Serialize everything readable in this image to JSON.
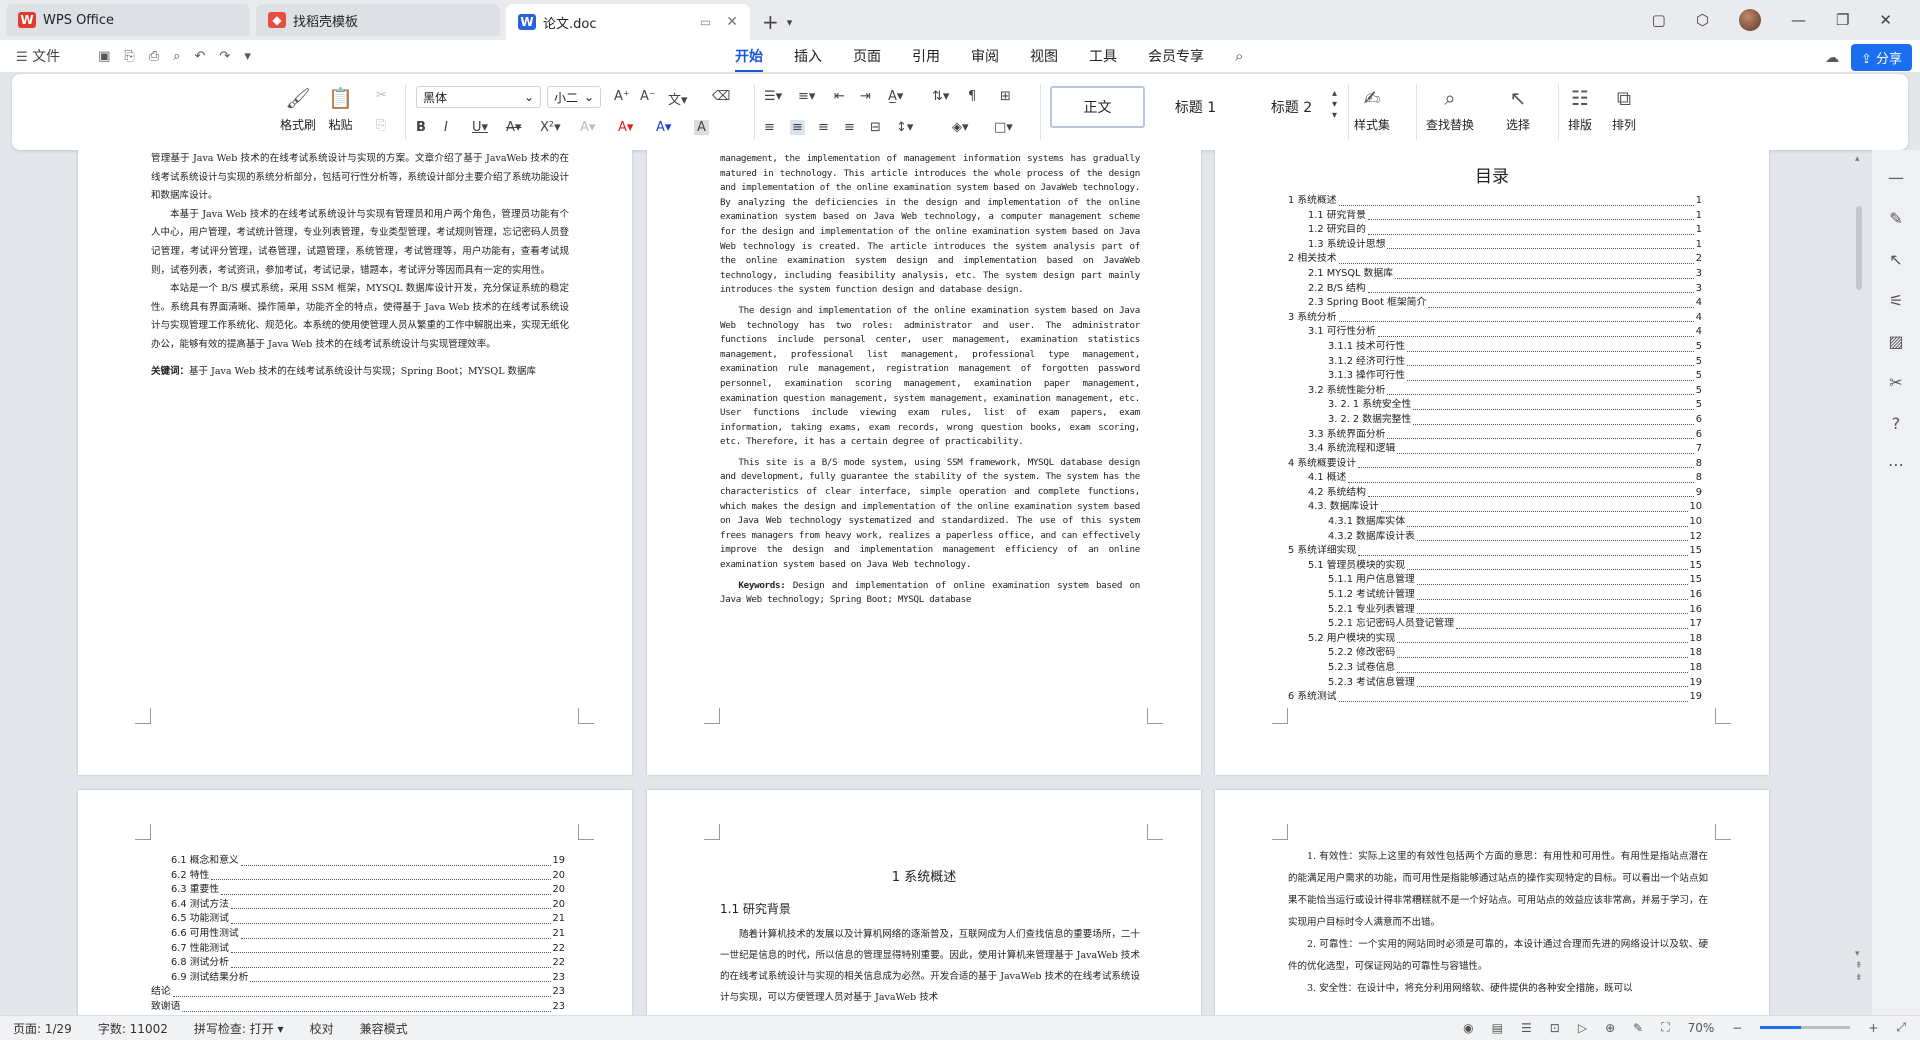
{
  "tabs": [
    {
      "label": "WPS Office",
      "icon": "wps-logo"
    },
    {
      "label": "找稻壳模板",
      "icon": "docer-logo"
    },
    {
      "label": "论文.doc",
      "icon": "word-doc-icon"
    }
  ],
  "menu": {
    "file": "文件",
    "tabs": [
      "开始",
      "插入",
      "页面",
      "引用",
      "审阅",
      "视图",
      "工具",
      "会员专享"
    ],
    "share": "分享"
  },
  "ribbon": {
    "format_painter": "格式刷",
    "paste": "粘贴",
    "font_name": "黑体",
    "font_size": "小二",
    "styles": [
      "正文",
      "标题 1",
      "标题 2"
    ],
    "style_set": "样式集",
    "find_replace": "查找替换",
    "select": "选择",
    "layout": "排版",
    "arrange": "排列"
  },
  "page1": {
    "paras": [
      "管理基于 Java Web 技术的在线考试系统设计与实现的方案。文章介绍了基于 JavaWeb 技术的在线考试系统设计与实现的系统分析部分，包括可行性分析等，系统设计部分主要介绍了系统功能设计和数据库设计。",
      "本基于 Java Web 技术的在线考试系统设计与实现有管理员和用户两个角色，管理员功能有个人中心，用户管理，考试统计管理，专业列表管理，专业类型管理，考试规则管理，忘记密码人员登记管理，考试评分管理，试卷管理，试题管理，系统管理，考试管理等，用户功能有，查看考试规则，试卷列表，考试资讯，参加考试，考试记录，错题本，考试评分等因而具有一定的实用性。",
      "本站是一个 B/S 模式系统，采用 SSM 框架，MYSQL 数据库设计开发，充分保证系统的稳定性。系统具有界面清晰、操作简单，功能齐全的特点，使得基于 Java Web 技术的在线考试系统设计与实现管理工作系统化、规范化。本系统的使用使管理人员从繁重的工作中解脱出来，实现无纸化办公，能够有效的提高基于 Java Web 技术的在线考试系统设计与实现管理效率。"
    ],
    "keywords_label": "关键词：",
    "keywords": "基于 Java Web 技术的在线考试系统设计与实现；Spring Boot；MYSQL 数据库"
  },
  "page2": {
    "paras": [
      "management, the implementation of management information systems has gradually matured in technology. This article introduces the whole process of the design and implementation of the online examination system based on JavaWeb technology. By analyzing the deficiencies in the design and implementation of the online examination system based on Java Web technology, a computer management scheme for the design and implementation of the online examination system based on Java Web technology is created. The article introduces the system analysis part of the online examination system design and implementation based on JavaWeb technology, including feasibility analysis, etc. The system design part mainly introduces the system function design and database design.",
      "The design and implementation of the online examination system based on Java Web technology has two roles: administrator and user. The administrator functions include personal center, user management, examination statistics management, professional list management, professional type management, examination rule management, registration management of forgotten password personnel, examination scoring management, examination paper management, examination question management, system management, examination management, etc. User functions include viewing exam rules, list of exam papers, exam information, taking exams, exam records, wrong question books, exam scoring, etc. Therefore, it has a certain degree of practicability.",
      "This site is a B/S mode system, using SSM framework, MYSQL database design and development, fully guarantee the stability of the system. The system has the characteristics of clear interface, simple operation and complete functions, which makes the design and implementation of the online examination system based on Java Web technology systematized and standardized. The use of this system frees managers from heavy work, realizes a paperless office, and can effectively improve the design and implementation management efficiency of an online examination system based on Java Web technology."
    ],
    "keywords_label": "Keywords:",
    "keywords": "Design and implementation of online examination system based on Java Web technology; Spring Boot; MYSQL database"
  },
  "page3": {
    "title": "目录",
    "toc": [
      {
        "t": "1 系统概述",
        "p": "1",
        "l": 0
      },
      {
        "t": "1.1 研究背景",
        "p": "1",
        "l": 1
      },
      {
        "t": "1.2 研究目的",
        "p": "1",
        "l": 1
      },
      {
        "t": "1.3 系统设计思想",
        "p": "1",
        "l": 1
      },
      {
        "t": "2 相关技术",
        "p": "2",
        "l": 0
      },
      {
        "t": "2.1 MYSQL 数据库",
        "p": "3",
        "l": 1
      },
      {
        "t": "2.2 B/S 结构",
        "p": "3",
        "l": 1
      },
      {
        "t": "2.3 Spring Boot 框架简介",
        "p": "4",
        "l": 1
      },
      {
        "t": "3 系统分析",
        "p": "4",
        "l": 0
      },
      {
        "t": "3.1 可行性分析",
        "p": "4",
        "l": 1
      },
      {
        "t": "3.1.1 技术可行性",
        "p": "5",
        "l": 2
      },
      {
        "t": "3.1.2 经济可行性",
        "p": "5",
        "l": 2
      },
      {
        "t": "3.1.3 操作可行性",
        "p": "5",
        "l": 2
      },
      {
        "t": "3.2 系统性能分析",
        "p": "5",
        "l": 1
      },
      {
        "t": "3. 2. 1  系统安全性",
        "p": "5",
        "l": 2
      },
      {
        "t": "3. 2. 2  数据完整性",
        "p": "6",
        "l": 2
      },
      {
        "t": "3.3 系统界面分析",
        "p": "6",
        "l": 1
      },
      {
        "t": "3.4 系统流程和逻辑",
        "p": "7",
        "l": 1
      },
      {
        "t": "4 系统概要设计",
        "p": "8",
        "l": 0
      },
      {
        "t": "4.1 概述",
        "p": "8",
        "l": 1
      },
      {
        "t": "4.2 系统结构",
        "p": "9",
        "l": 1
      },
      {
        "t": "4.3. 数据库设计",
        "p": "10",
        "l": 1
      },
      {
        "t": "4.3.1 数据库实体",
        "p": "10",
        "l": 2
      },
      {
        "t": "4.3.2 数据库设计表",
        "p": "12",
        "l": 2
      },
      {
        "t": "5 系统详细实现",
        "p": "15",
        "l": 0
      },
      {
        "t": "5.1  管理员模块的实现",
        "p": "15",
        "l": 1
      },
      {
        "t": "5.1.1  用户信息管理",
        "p": "15",
        "l": 2
      },
      {
        "t": "5.1.2  考试统计管理",
        "p": "16",
        "l": 2
      },
      {
        "t": "5.2.1  专业列表管理",
        "p": "16",
        "l": 2
      },
      {
        "t": "5.2.1  忘记密码人员登记管理",
        "p": "17",
        "l": 2
      },
      {
        "t": "5.2  用户模块的实现",
        "p": "18",
        "l": 1
      },
      {
        "t": "5.2.2  修改密码",
        "p": "18",
        "l": 2
      },
      {
        "t": "5.2.3  试卷信息",
        "p": "18",
        "l": 2
      },
      {
        "t": "5.2.3  考试信息管理",
        "p": "19",
        "l": 2
      },
      {
        "t": "6 系统测试",
        "p": "19",
        "l": 0
      }
    ]
  },
  "page4": {
    "toc": [
      {
        "t": "6.1 概念和意义",
        "p": "19"
      },
      {
        "t": "6.2 特性",
        "p": "20"
      },
      {
        "t": "6.3 重要性",
        "p": "20"
      },
      {
        "t": "6.4 测试方法",
        "p": "20"
      },
      {
        "t": "6.5  功能测试",
        "p": "21"
      },
      {
        "t": "6.6 可用性测试",
        "p": "21"
      },
      {
        "t": "6.7 性能测试",
        "p": "22"
      },
      {
        "t": "6.8 测试分析",
        "p": "22"
      },
      {
        "t": "6.9 测试结果分析",
        "p": "23"
      },
      {
        "t": "结论",
        "p": "23",
        "l": 0
      },
      {
        "t": "致谢语",
        "p": "23",
        "l": 0
      }
    ]
  },
  "page5": {
    "h1": "1 系统概述",
    "h2": "1.1  研究背景",
    "para": "随着计算机技术的发展以及计算机网络的逐渐普及，互联网成为人们查找信息的重要场所，二十一世纪是信息的时代，所以信息的管理显得特别重要。因此，使用计算机来管理基于 JavaWeb 技术的在线考试系统设计与实现的相关信息成为必然。开发合适的基于 JavaWeb 技术的在线考试系统设计与实现，可以方便管理人员对基于 JavaWeb 技术"
  },
  "page6": {
    "items": [
      "1.      有效性：实际上这里的有效性包括两个方面的意思：有用性和可用性。有用性是指站点潜在的能满足用户需求的功能，而可用性是指能够通过站点的操作实现特定的目标。可以看出一个站点如果不能恰当运行或设计得非常糟糕就不是一个好站点。可用站点的效益应该非常高，并易于学习，在实现用户目标时令人满意而不出错。",
      "2.      可靠性：一个实用的网站同时必须是可靠的，本设计通过合理而先进的网络设计以及软、硬件的优化选型，可保证网站的可靠性与容错性。",
      "3.      安全性：在设计中，将充分利用网络软、硬件提供的各种安全措施，既可以"
    ]
  },
  "status": {
    "page": "页面: 1/29",
    "words": "字数: 11002",
    "spell": "拼写检查: 打开",
    "proof": "校对",
    "compat": "兼容模式",
    "zoom": "70%",
    "zoom_fraction": 0.45
  }
}
